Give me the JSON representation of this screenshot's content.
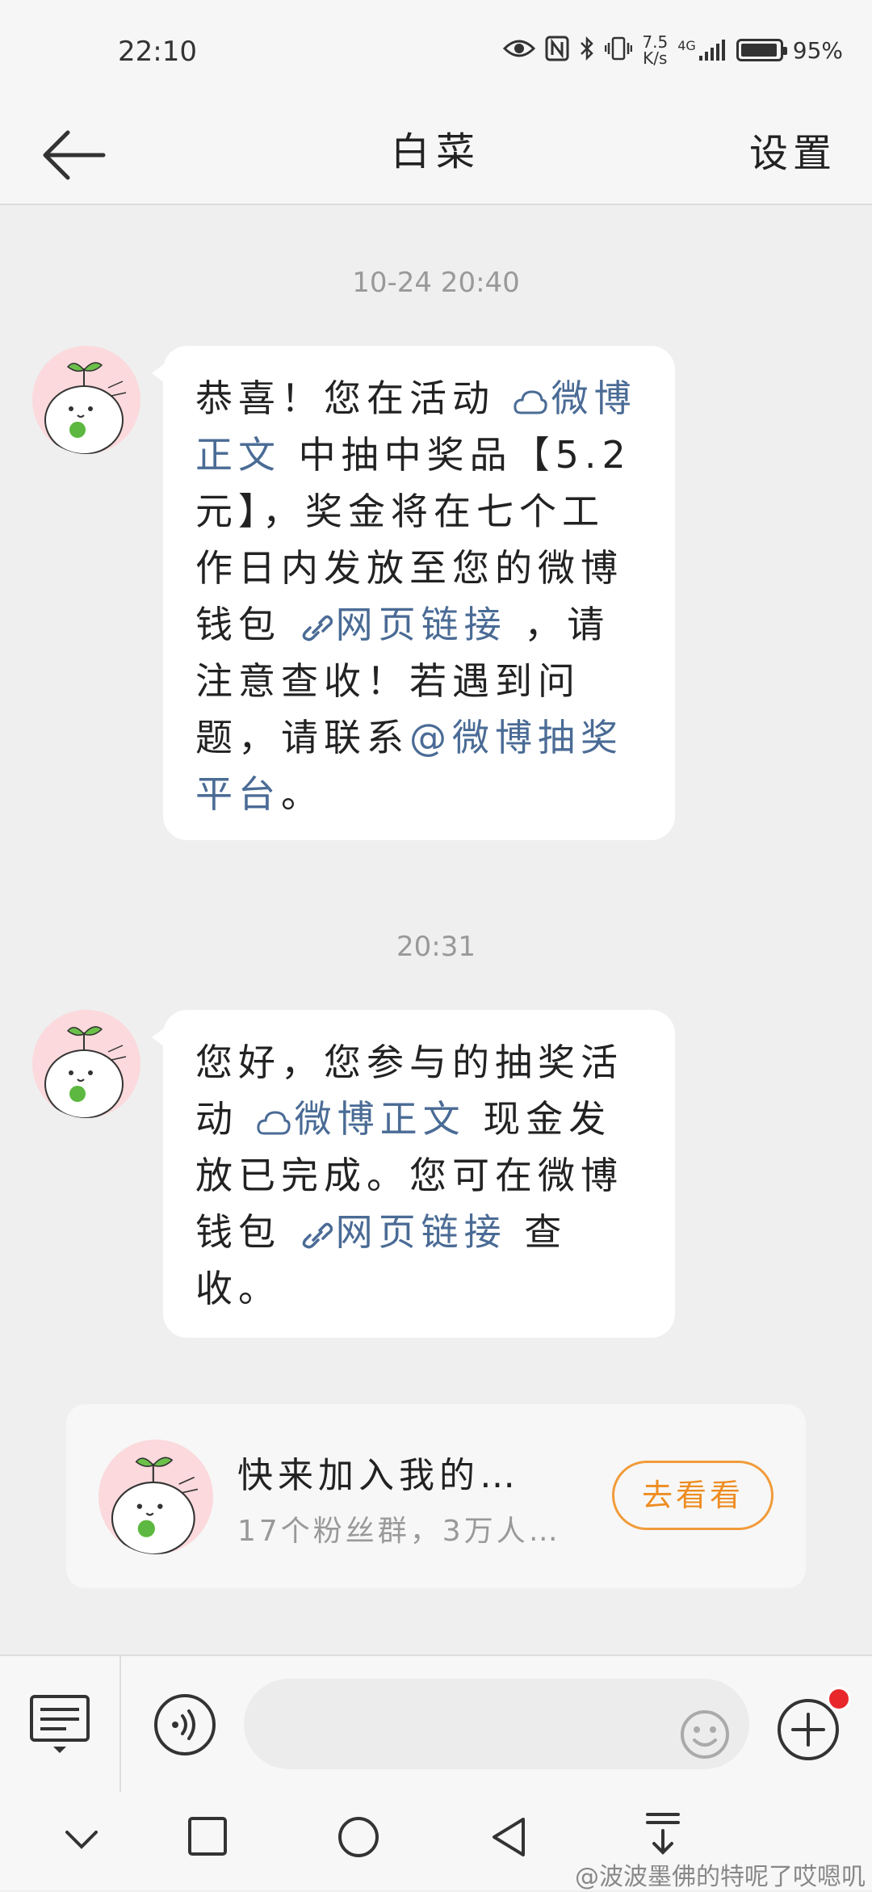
{
  "status_bar": {
    "time": "22:10",
    "speed_value": "7.5",
    "speed_unit": "K/s",
    "network": "4G",
    "battery": "95%",
    "battery_level": 0.95
  },
  "header": {
    "title": "白菜",
    "settings_label": "设置"
  },
  "messages": [
    {
      "timestamp": "10-24 20:40",
      "parts": [
        {
          "t": "恭喜！您在活动 "
        },
        {
          "t": "微博正文",
          "link": true,
          "icon": "weibo-cloud-icon"
        },
        {
          "t": " 中抽中奖品【5.2元】，奖金将在七个工作日内发放至您的微博钱包 "
        },
        {
          "t": "网页链接",
          "link": true,
          "icon": "link-icon"
        },
        {
          "t": " ，请注意查收！若遇到问题，请联系"
        },
        {
          "t": "@微博抽奖平台",
          "link": true
        },
        {
          "t": "。"
        }
      ]
    },
    {
      "timestamp": "20:31",
      "parts": [
        {
          "t": "您好，您参与的抽奖活动 "
        },
        {
          "t": "微博正文",
          "link": true,
          "icon": "weibo-cloud-icon"
        },
        {
          "t": " 现金发放已完成。您可在微博钱包 "
        },
        {
          "t": "网页链接",
          "link": true,
          "icon": "link-icon"
        },
        {
          "t": " 查收。"
        }
      ]
    }
  ],
  "promo": {
    "title": "快来加入我的…",
    "subtitle": "17个粉丝群，3万人…",
    "button_label": "去看看"
  },
  "input": {
    "placeholder": ""
  },
  "watermark": "@波波墨佛的特呢了哎嗯叽",
  "colors": {
    "link": "#4a6b95",
    "accent_orange": "#ee8d22",
    "badge_red": "#e8272a",
    "avatar_bg": "#fbd9dc"
  }
}
